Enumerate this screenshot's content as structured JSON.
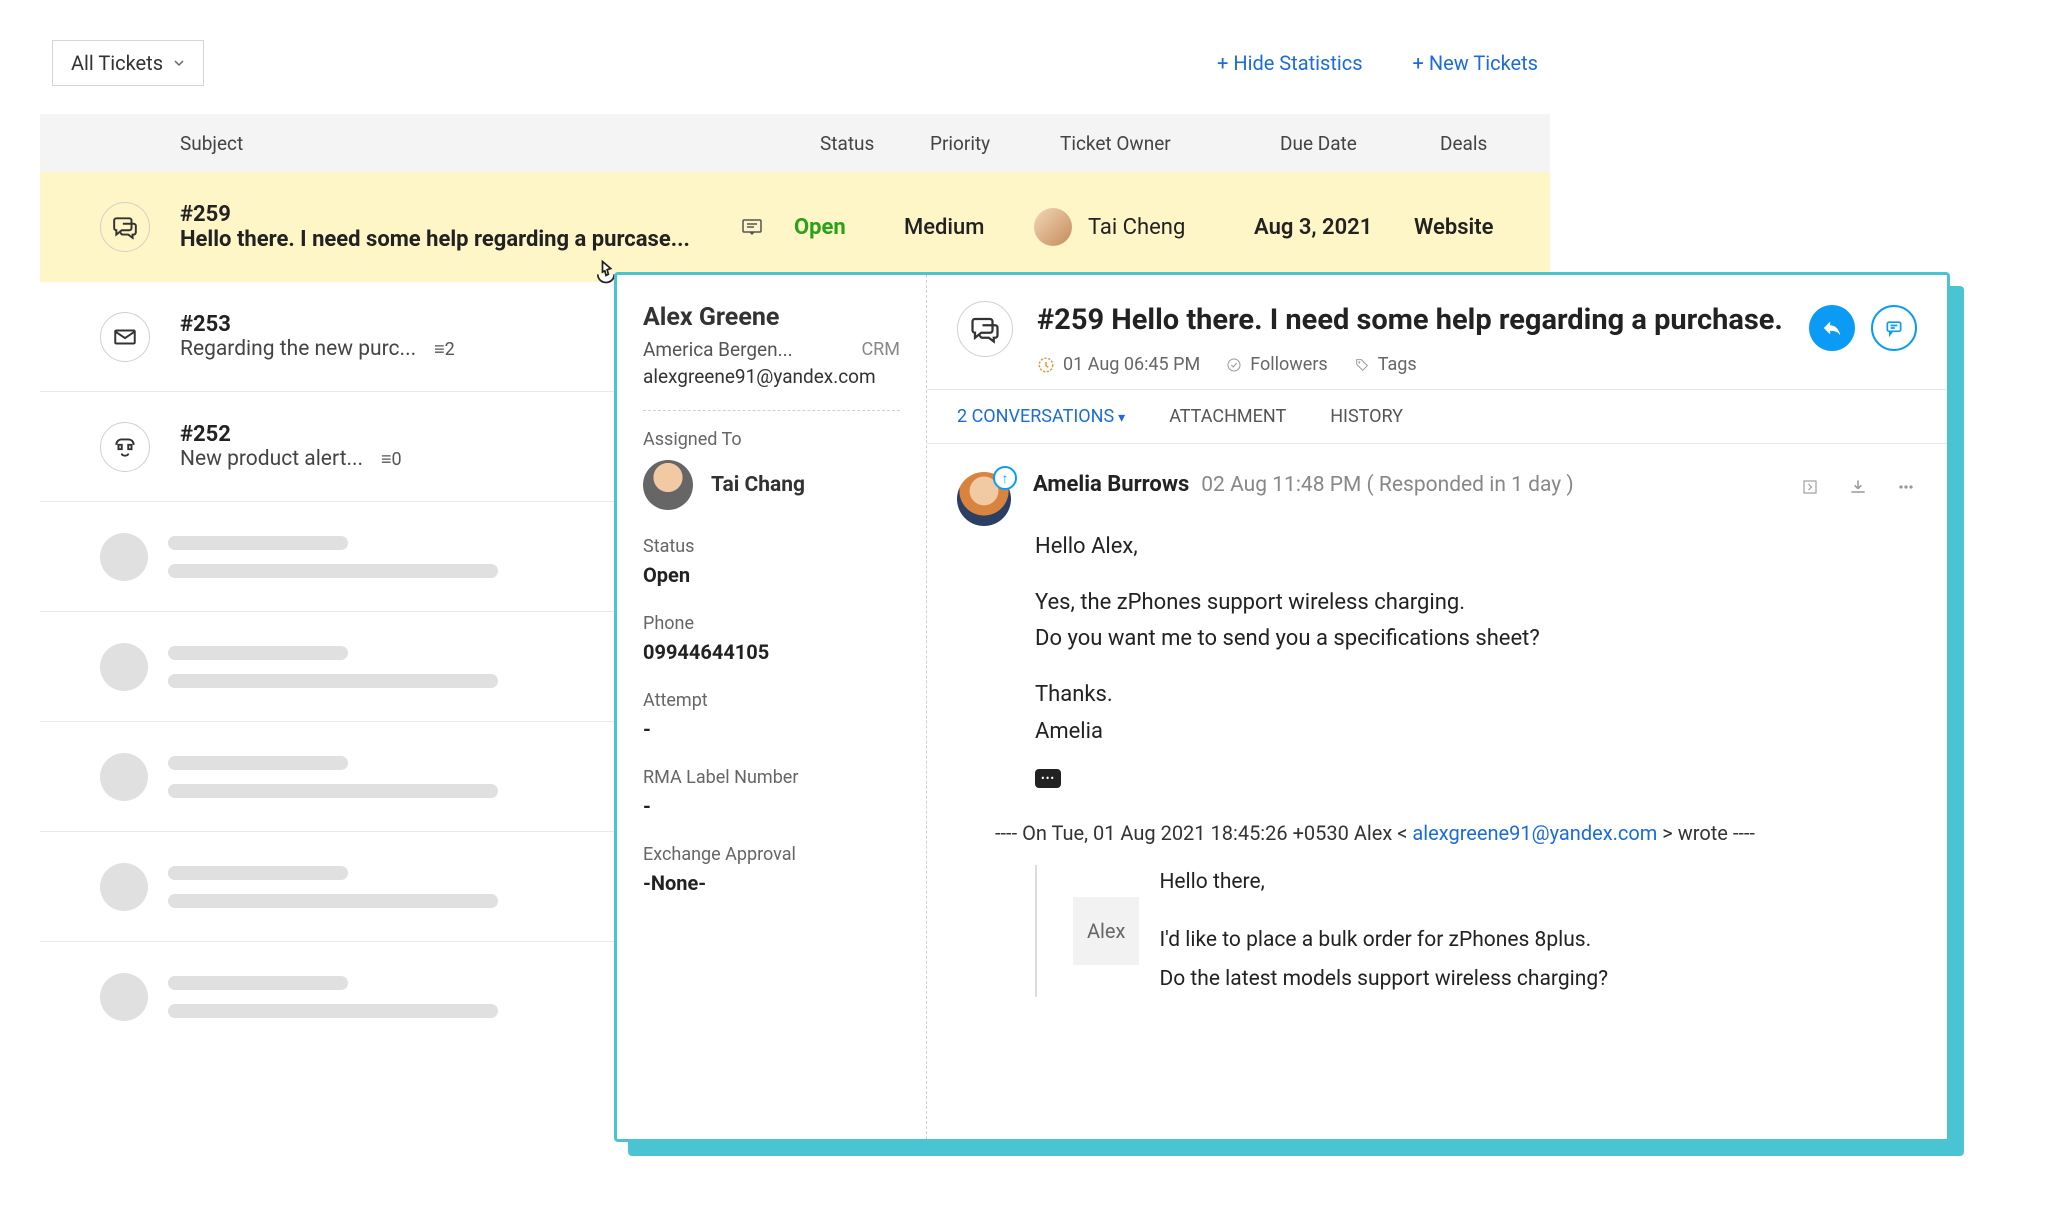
{
  "topbar": {
    "filter_label": "All Tickets",
    "link_hide_stats": "+ Hide Statistics",
    "link_new_tickets": "+ New Tickets"
  },
  "columns": {
    "subject": "Subject",
    "status": "Status",
    "priority": "Priority",
    "owner": "Ticket Owner",
    "due": "Due Date",
    "deals": "Deals"
  },
  "rows": [
    {
      "id": "#259",
      "subject": "Hello there. I need some help regarding a purcase...",
      "status": "Open",
      "priority": "Medium",
      "owner": "Tai Cheng",
      "due": "Aug 3, 2021",
      "deals": "Website",
      "channel": "chat"
    },
    {
      "id": "#253",
      "subject": "Regarding the new purc...",
      "count": "≡2",
      "channel": "email"
    },
    {
      "id": "#252",
      "subject": "New product alert...",
      "count": "≡0",
      "channel": "phone"
    }
  ],
  "panel": {
    "contact": {
      "name": "Alex Greene",
      "company": "America Bergen...",
      "crm": "CRM",
      "email": "alexgreene91@yandex.com"
    },
    "assigned_label": "Assigned To",
    "assigned_to": "Tai Chang",
    "fields": {
      "status_label": "Status",
      "status_value": "Open",
      "phone_label": "Phone",
      "phone_value": "09944644105",
      "attempt_label": "Attempt",
      "attempt_value": "-",
      "rma_label": "RMA Label Number",
      "rma_value": "-",
      "exchange_label": "Exchange Approval",
      "exchange_value": "-None-"
    },
    "ticket_title": "#259 Hello there. I need some help regarding a purchase.",
    "timestamp": "01 Aug 06:45 PM",
    "followers_label": "Followers",
    "tags_label": "Tags",
    "tabs": {
      "conversations": "2 CONVERSATIONS",
      "attachment": "ATTACHMENT",
      "history": "HISTORY"
    },
    "conversation": {
      "from": "Amelia Burrows",
      "time": "02 Aug 11:48 PM ( Responded in 1 day )",
      "body_greeting": "Hello Alex,",
      "body_l1": "Yes, the zPhones support wireless charging.",
      "body_l2": "Do you want me to send you a specifications sheet?",
      "body_l3": "Thanks.",
      "body_l4": "Amelia",
      "quote_prefix": "---- On Tue, 01 Aug 2021 18:45:26 +0530 Alex < ",
      "quote_email": "alexgreene91@yandex.com",
      "quote_suffix": " > wrote ----",
      "quoted_name": "Alex",
      "quoted_l1": "Hello there,",
      "quoted_l2": "I'd like to place a bulk order for zPhones 8plus.",
      "quoted_l3": "Do the latest models support wireless charging?"
    }
  }
}
